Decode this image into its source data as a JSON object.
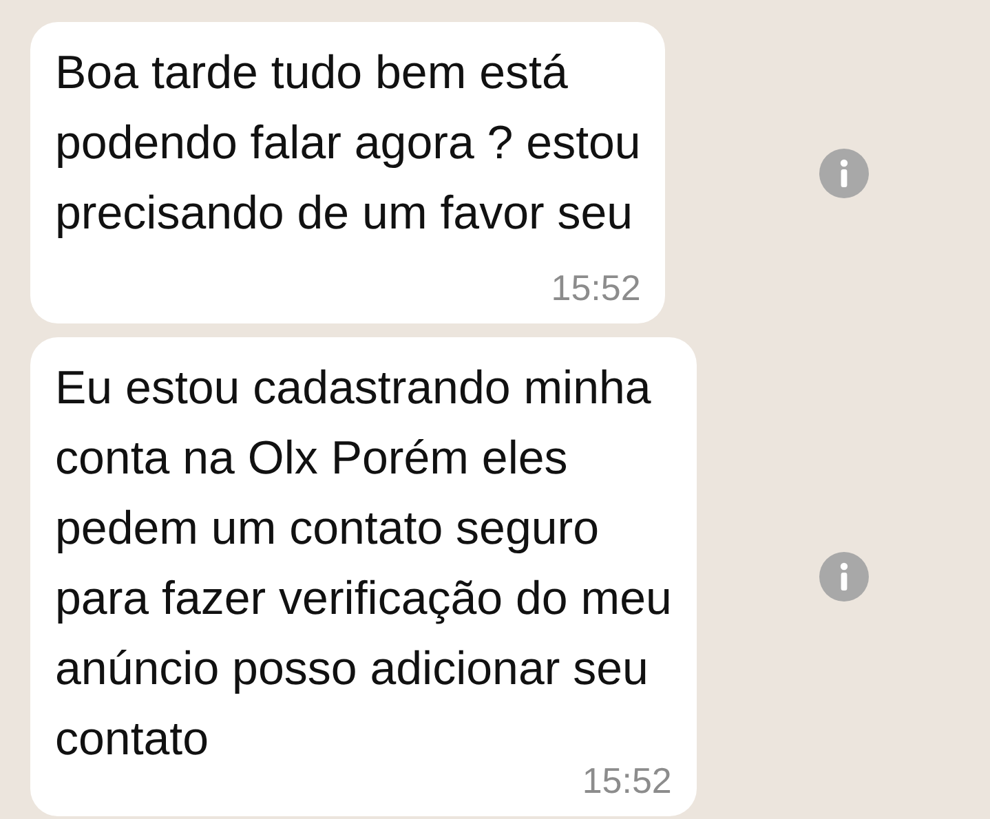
{
  "messages": [
    {
      "lines": [
        "Boa tarde tudo bem está",
        "podendo falar agora ? estou",
        "precisando de um favor seu"
      ],
      "time": "15:52"
    },
    {
      "lines": [
        "Eu estou cadastrando minha",
        "conta na Olx Porém eles",
        "pedem um contato seguro",
        "para fazer verificação do meu",
        "anúncio posso adicionar seu",
        "contato"
      ],
      "time": "15:52"
    }
  ]
}
